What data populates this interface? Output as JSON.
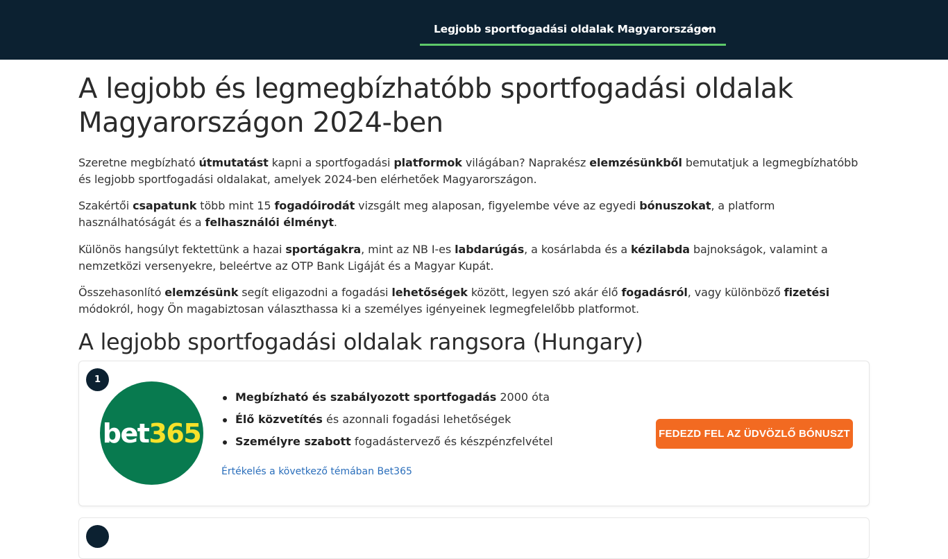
{
  "nav": {
    "label": "Legjobb sportfogadási oldalak Magyarországon"
  },
  "page": {
    "title": "A legjobb és legmegbízhatóbb sportfogadási oldalak Magyarországon 2024-ben",
    "p1": [
      "Szeretne megbízható ",
      "útmutatást",
      " kapni a sportfogadási ",
      "platformok",
      " világában? Naprakész ",
      "elemzésünkből",
      " bemutatjuk a legmegbízhatóbb és legjobb sportfogadási oldalakat, amelyek 2024-ben elérhetőek Magyarországon."
    ],
    "p2": [
      "Szakértői ",
      "csapatunk",
      " több mint 15 ",
      "fogadóirodát",
      " vizsgált meg alaposan, figyelembe véve az egyedi ",
      "bónuszokat",
      ", a platform használhatóságát és a ",
      "felhasználói élményt",
      "."
    ],
    "p3": [
      "Különös hangsúlyt fektettünk a hazai ",
      "sportágakra",
      ", mint az NB I-es ",
      "labdarúgás",
      ", a kosárlabda és a ",
      "kézilabda",
      " bajnokságok, valamint a nemzetközi versenyekre, beleértve az OTP Bank Ligáját és a Magyar Kupát."
    ],
    "p4": [
      "Összehasonlító ",
      "elemzésünk",
      " segít eligazodni a fogadási ",
      "lehetőségek",
      " között, legyen szó akár élő ",
      "fogadásról",
      ", vagy különböző ",
      "fizetési",
      " módokról, hogy Ön magabiztosan választhassa ki a személyes igényeinek legmegfelelőbb platformot."
    ],
    "ranking_title": "A legjobb sportfogadási oldalak rangsora (Hungary)"
  },
  "listing": {
    "rank": "1",
    "logo": {
      "part1": "bet",
      "part2": "365",
      "bg_color": "#087a4f",
      "accent_color": "#f6e12a"
    },
    "features": [
      {
        "bold": "Megbízható és szabályozott sportfogadás",
        "rest": " 2000 óta"
      },
      {
        "bold": "Élő közvetítés",
        "rest": " és azonnali fogadási lehetőségek"
      },
      {
        "bold": "Személyre szabott",
        "rest": " fogadástervező és készpénzfelvétel"
      }
    ],
    "review_link": "Értékelés a következő témában Bet365",
    "cta_label": "FEDEZD FEL AZ ÜDVÖZLŐ BÓNUSZT",
    "cta_color": "#f26a21"
  },
  "colors": {
    "header_bg": "#0c2131",
    "nav_underline": "#5ec96a",
    "link": "#2a6ebb"
  }
}
